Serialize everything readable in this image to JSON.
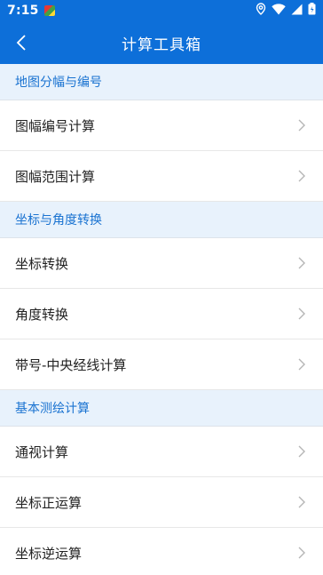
{
  "status_bar": {
    "time": "7:15",
    "icons": [
      "notification-app-icon",
      "location-icon",
      "wifi-icon",
      "signal-icon",
      "battery-icon"
    ]
  },
  "app_bar": {
    "title": "计算工具箱",
    "back_icon": "back-arrow-icon"
  },
  "sections": [
    {
      "header": "地图分幅与编号",
      "items": [
        {
          "label": "图幅编号计算"
        },
        {
          "label": "图幅范围计算"
        }
      ]
    },
    {
      "header": "坐标与角度转换",
      "items": [
        {
          "label": "坐标转换"
        },
        {
          "label": "角度转换"
        },
        {
          "label": "带号-中央经线计算"
        }
      ]
    },
    {
      "header": "基本测绘计算",
      "items": [
        {
          "label": "通视计算"
        },
        {
          "label": "坐标正运算"
        },
        {
          "label": "坐标逆运算"
        }
      ]
    }
  ],
  "colors": {
    "primary": "#0d6fd9",
    "section_bg": "#e8f2fc",
    "section_text": "#1a73d1",
    "divider": "#e7e7e7",
    "chevron": "#b5b5b5"
  }
}
